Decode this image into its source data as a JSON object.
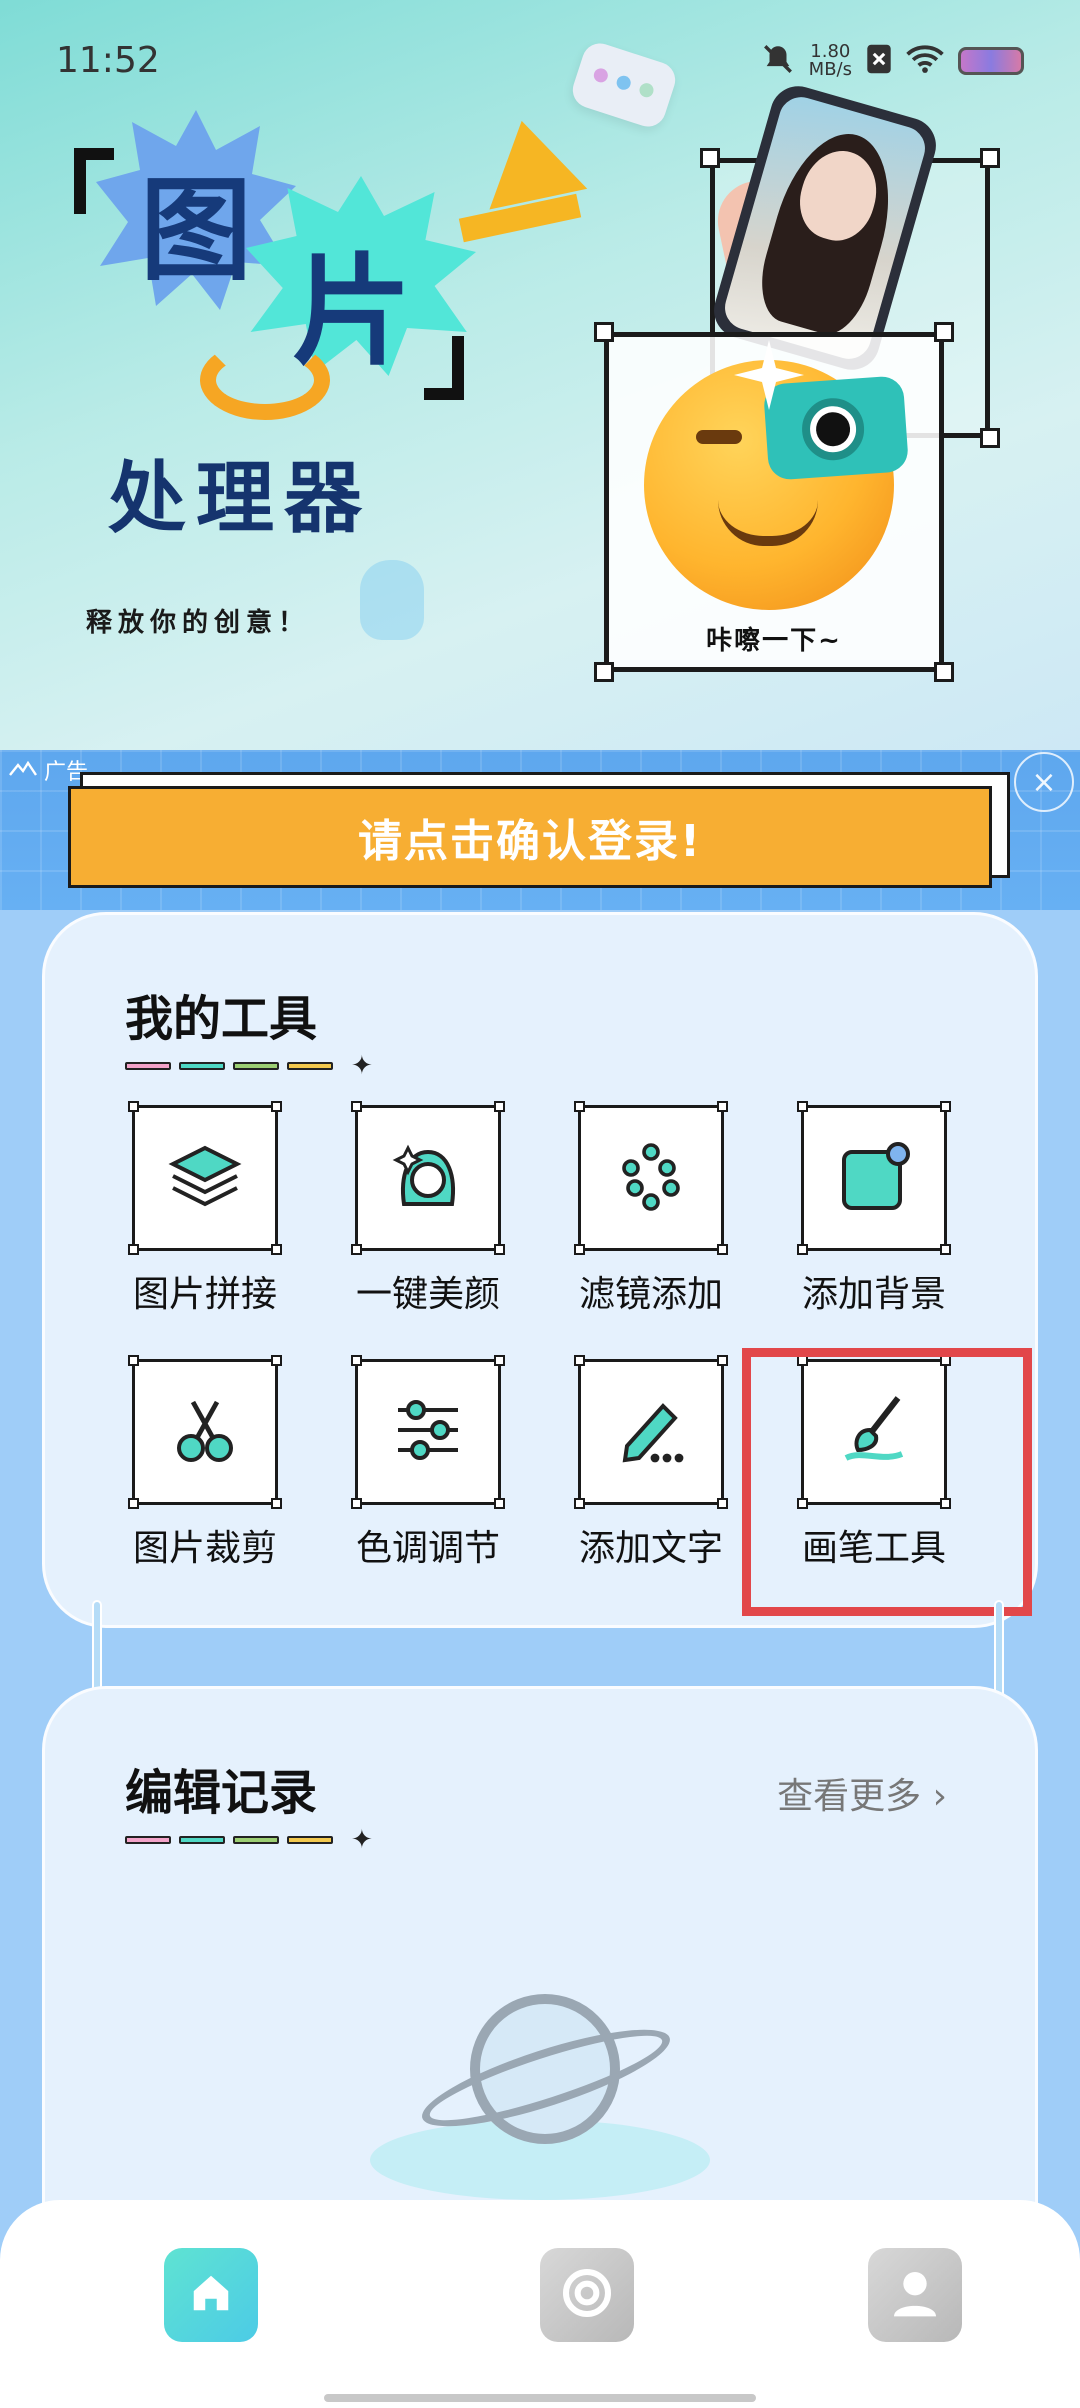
{
  "status_bar": {
    "time": "11:52",
    "speed_value": "1.80",
    "speed_unit": "MB/s"
  },
  "hero": {
    "brand_char_1": "图",
    "brand_char_2": "片",
    "title": "处理器",
    "tagline": "释放你的创意！",
    "emoji_caption": "咔嚓一下~"
  },
  "ad": {
    "label": "广告",
    "button_text": "请点击确认登录!",
    "close_icon": "close-icon"
  },
  "tools_section": {
    "title": "我的工具",
    "underline_colors": [
      "#f3a3c9",
      "#4fd8c4",
      "#9ccf73",
      "#f3c94e"
    ],
    "tools": [
      {
        "label": "图片拼接",
        "icon": "layers-icon"
      },
      {
        "label": "一键美颜",
        "icon": "beauty-face-icon"
      },
      {
        "label": "滤镜添加",
        "icon": "filter-dots-icon"
      },
      {
        "label": "添加背景",
        "icon": "background-square-icon"
      },
      {
        "label": "图片裁剪",
        "icon": "scissors-icon"
      },
      {
        "label": "色调调节",
        "icon": "sliders-icon"
      },
      {
        "label": "添加文字",
        "icon": "pencil-icon"
      },
      {
        "label": "画笔工具",
        "icon": "brush-icon"
      }
    ],
    "highlighted_tool": "画笔工具"
  },
  "history_section": {
    "title": "编辑记录",
    "view_more": "查看更多"
  },
  "navbar": {
    "items": [
      {
        "name": "home",
        "icon": "home-icon",
        "active": true
      },
      {
        "name": "camera",
        "icon": "camera-icon",
        "active": false
      },
      {
        "name": "profile",
        "icon": "profile-icon",
        "active": false
      }
    ]
  },
  "colors": {
    "accent": "#4fd8c4",
    "ad_button": "#f7ae33",
    "highlight_border": "#e2474a",
    "background": "#9fcdf8"
  }
}
